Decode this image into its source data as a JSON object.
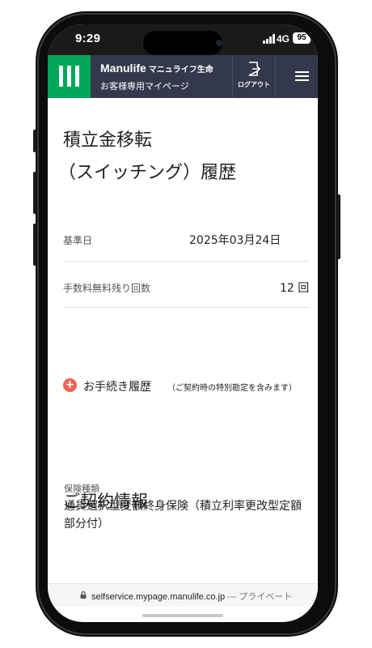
{
  "status": {
    "time": "9:29",
    "network": "4G",
    "battery": "95"
  },
  "header": {
    "brand": "Manulife",
    "brand_jp": "マニュライフ生命",
    "subtitle": "お客様専用マイページ",
    "logout_label": "ログアウト",
    "logo_color": "#00a758",
    "bg_color": "#34384b"
  },
  "page": {
    "title_line1": "積立金移転",
    "title_line2": "（スイッチング）履歴"
  },
  "info": {
    "base_date_label": "基準日",
    "base_date_value": "2025年03月24日",
    "fee_free_label": "手数料無料残り回数",
    "fee_free_value": "12 回"
  },
  "procedure": {
    "label": "お手続き履歴",
    "note": "（ご契約時の特別勘定を含みます）",
    "icon_color": "#ec6453"
  },
  "contract": {
    "section_title": "ご契約情報",
    "insurance_type_label": "保険種類",
    "insurance_type_value": "通貨選択型変額終身保険（積立利率更改型定額部分付）"
  },
  "browser": {
    "url": "selfservice.mypage.manulife.co.jp",
    "privacy": "— プライベート"
  }
}
